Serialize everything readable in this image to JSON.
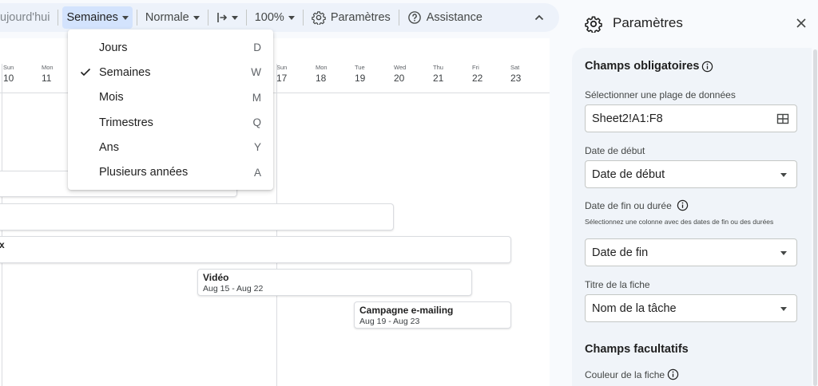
{
  "toolbar": {
    "today": "ujourd'hui",
    "scale": "Semaines",
    "view": "Normale",
    "zoom": "100%",
    "settings": "Paramètres",
    "help": "Assistance"
  },
  "menu": {
    "items": [
      {
        "label": "Jours",
        "key": "D"
      },
      {
        "label": "Semaines",
        "key": "W"
      },
      {
        "label": "Mois",
        "key": "M"
      },
      {
        "label": "Trimestres",
        "key": "Q"
      },
      {
        "label": "Ans",
        "key": "Y"
      },
      {
        "label": "Plusieurs années",
        "key": "A"
      }
    ],
    "selected_index": 1
  },
  "timeline": {
    "days": [
      {
        "name": "Sun",
        "num": "10"
      },
      {
        "name": "Mon",
        "num": "11"
      },
      {
        "name": "Sun",
        "num": "17"
      },
      {
        "name": "Mon",
        "num": "18"
      },
      {
        "name": "Tue",
        "num": "19"
      },
      {
        "name": "Wed",
        "num": "20"
      },
      {
        "name": "Thu",
        "num": "21"
      },
      {
        "name": "Fri",
        "num": "22"
      },
      {
        "name": "Sat",
        "num": "23"
      }
    ],
    "tasks": [
      {
        "title": "",
        "dates": ""
      },
      {
        "title": "",
        "dates": ""
      },
      {
        "title": "x",
        "dates": ""
      },
      {
        "title": "Vidéo",
        "dates": "Aug 15 - Aug 22"
      },
      {
        "title": "Campagne e-mailing",
        "dates": "Aug 19 - Aug 23"
      }
    ]
  },
  "panel": {
    "title": "Paramètres",
    "required_heading": "Champs obligatoires",
    "range_label": "Sélectionner une plage de données",
    "range_value": "Sheet2!A1:F8",
    "start_label": "Date de début",
    "start_value": "Date de début",
    "end_label": "Date de fin ou durée",
    "end_hint": "Sélectionnez une colonne avec des dates de fin ou des durées",
    "end_value": "Date de fin",
    "card_title_label": "Titre de la fiche",
    "card_title_value": "Nom de la tâche",
    "optional_heading": "Champs facultatifs",
    "card_color_label": "Couleur de la fiche"
  },
  "icons": {
    "settings": "gear-icon",
    "help": "help-circle-icon",
    "collapse": "chevron-up-icon",
    "close": "close-icon",
    "info": "info-icon",
    "range": "grid-icon",
    "check": "check-icon",
    "insert": "insert-column-icon"
  }
}
